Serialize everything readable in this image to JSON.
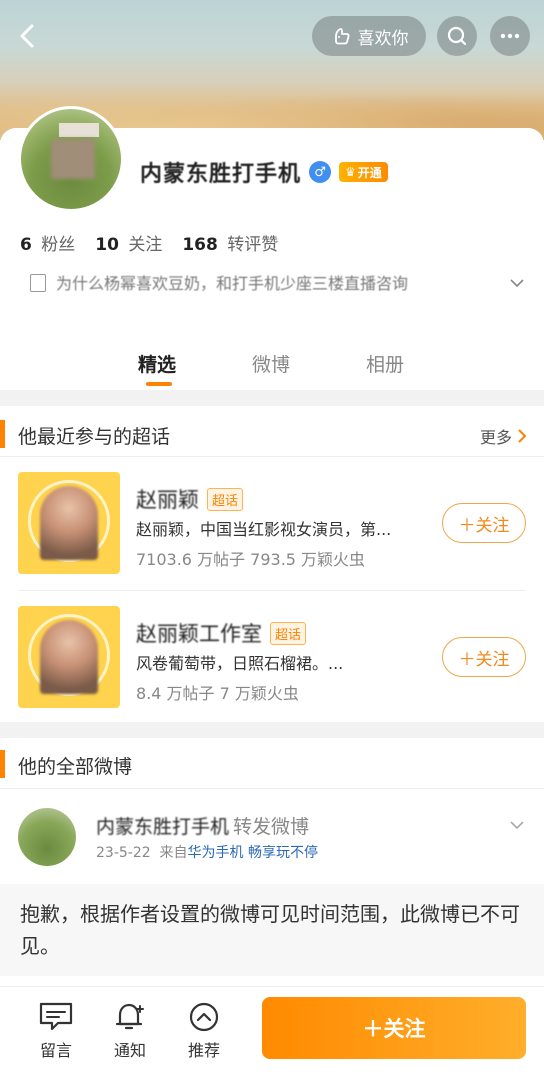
{
  "header": {
    "like_label": "喜欢你",
    "icons": [
      "back-arrow-icon",
      "like-hand-icon",
      "search-icon",
      "more-icon"
    ]
  },
  "profile": {
    "name": "内蒙东胜打手机",
    "gender": "male",
    "vip_label": "开通",
    "stats": {
      "fans_count": "6",
      "fans_label": "粉丝",
      "follow_count": "10",
      "follow_label": "关注",
      "interactions_count": "168",
      "interactions_label": "转评赞"
    },
    "bio": "为什么杨幂喜欢豆奶，和打手机少座三楼直播咨询",
    "tabs": [
      "精选",
      "微博",
      "相册"
    ],
    "active_tab": 0
  },
  "super_topics": {
    "title": "他最近参与的超话",
    "more_label": "更多",
    "tag_label": "超话",
    "follow_label": "关注",
    "items": [
      {
        "name": "赵丽颖",
        "desc": "赵丽颖，中国当红影视女演员，第...",
        "meta": "7103.6 万帖子 793.5 万颖火虫"
      },
      {
        "name": "赵丽颖工作室",
        "desc": "风卷葡萄带，日照石榴裙。...",
        "meta": "8.4 万帖子 7 万颖火虫"
      }
    ]
  },
  "posts_section": {
    "title": "他的全部微博",
    "post": {
      "author": "内蒙东胜打手机",
      "action": "转发微博",
      "date": "23-5-22",
      "from_prefix": "来自",
      "source": "华为手机 畅享玩不停",
      "notice": "抱歉，根据作者设置的微博可见时间范围，此微博已不可见。"
    }
  },
  "bottom_bar": {
    "message_label": "留言",
    "notify_label": "通知",
    "recommend_label": "推荐",
    "follow_label": "＋关注"
  },
  "colors": {
    "accent": "#ff8200",
    "link": "#2b6ab8",
    "gender_male": "#3f8ef0"
  }
}
